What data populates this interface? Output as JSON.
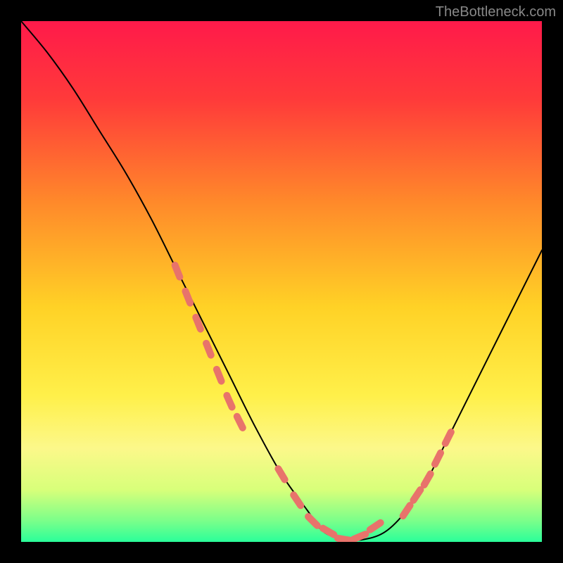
{
  "watermark": "TheBottleneck.com",
  "chart_data": {
    "type": "line",
    "title": "",
    "xlabel": "",
    "ylabel": "",
    "xlim": [
      0,
      100
    ],
    "ylim": [
      0,
      100
    ],
    "background_gradient": {
      "stops": [
        {
          "offset": 0.0,
          "color": "#ff1a4a"
        },
        {
          "offset": 0.15,
          "color": "#ff3a3a"
        },
        {
          "offset": 0.35,
          "color": "#ff8a2a"
        },
        {
          "offset": 0.55,
          "color": "#ffd226"
        },
        {
          "offset": 0.72,
          "color": "#fff04a"
        },
        {
          "offset": 0.82,
          "color": "#fcf88a"
        },
        {
          "offset": 0.9,
          "color": "#d8ff7a"
        },
        {
          "offset": 0.96,
          "color": "#7aff8a"
        },
        {
          "offset": 1.0,
          "color": "#2aff9a"
        }
      ]
    },
    "series": [
      {
        "name": "bottleneck-curve",
        "x": [
          0,
          5,
          10,
          15,
          20,
          25,
          30,
          35,
          40,
          45,
          50,
          55,
          58,
          62,
          66,
          70,
          74,
          78,
          82,
          86,
          90,
          94,
          98,
          100
        ],
        "y": [
          100,
          94,
          87,
          79,
          71,
          62,
          52,
          42,
          32,
          22,
          13,
          6,
          2,
          0.5,
          0.5,
          2,
          6,
          12,
          20,
          28,
          36,
          44,
          52,
          56
        ]
      }
    ],
    "marker_segments": [
      {
        "name": "left-markers",
        "x": [
          30,
          32,
          34,
          36,
          38,
          40,
          42
        ],
        "y": [
          52,
          47,
          42,
          37,
          32,
          27,
          23
        ]
      },
      {
        "name": "bottom-markers",
        "x": [
          50,
          53,
          56,
          59,
          62,
          65,
          68
        ],
        "y": [
          13,
          8,
          4,
          2,
          0.5,
          1,
          3
        ]
      },
      {
        "name": "right-markers",
        "x": [
          74,
          76,
          78,
          80,
          82
        ],
        "y": [
          6,
          9,
          12,
          16,
          20
        ]
      }
    ],
    "marker_color": "#e8736b",
    "curve_color": "#000000"
  }
}
